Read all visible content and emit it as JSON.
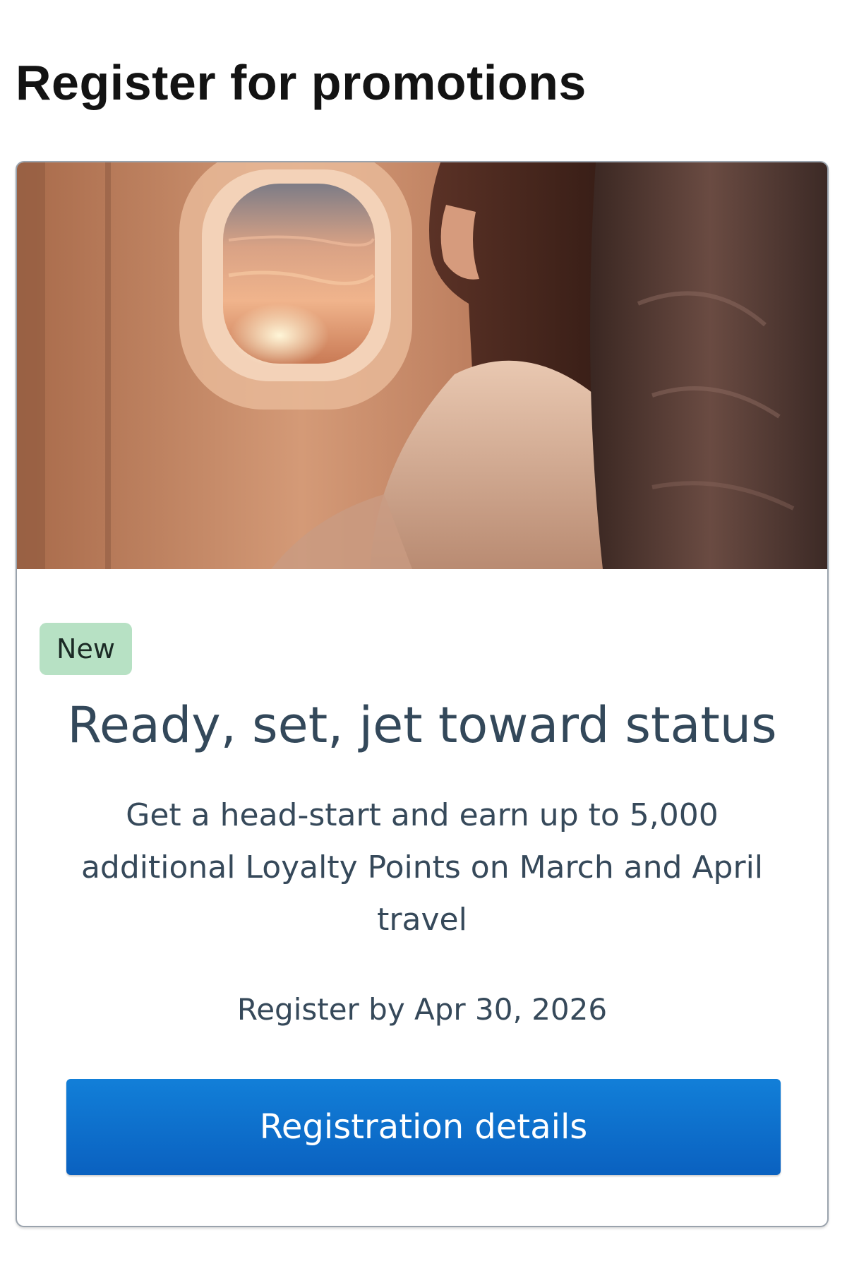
{
  "page": {
    "title": "Register for promotions"
  },
  "promotion": {
    "image_icon": "woman-airplane-window-photo",
    "badge": "New",
    "title": "Ready, set, jet toward status",
    "description": "Get a head-start and earn up to 5,000 additional Loyalty Points on March and April travel",
    "deadline": "Register by Apr 30, 2026",
    "button_label": "Registration details"
  },
  "colors": {
    "badge_background": "#b7e1c4",
    "button_blue": "#0a6ccc",
    "text_dark": "#36495a",
    "title_black": "#131313"
  }
}
